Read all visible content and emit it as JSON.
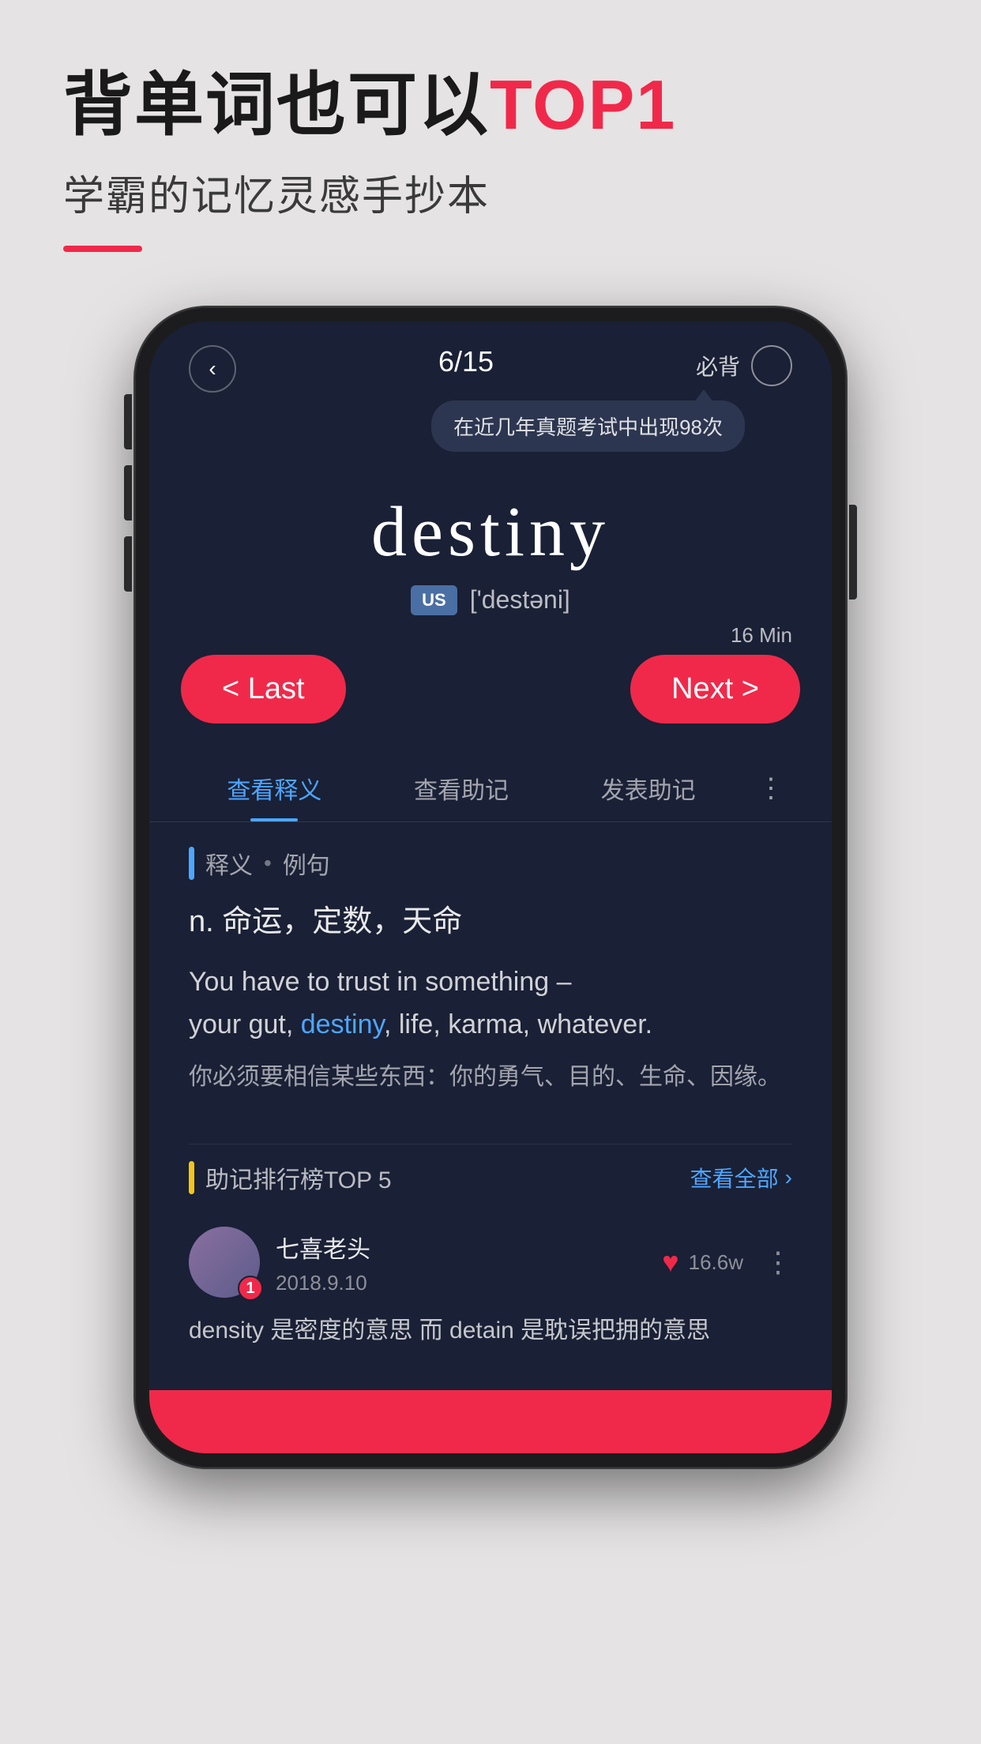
{
  "page": {
    "background_color": "#e5e3e3"
  },
  "header": {
    "title_part1": "背单词也可以",
    "title_highlight": "TOP1",
    "subtitle": "学霸的记忆灵感手抄本",
    "underline_color": "#f0294a"
  },
  "phone": {
    "progress": "6/15",
    "must_label": "必背",
    "tooltip_text": "在近几年真题考试中出现98次",
    "word": "destiny",
    "phonetic_tag": "US",
    "phonetic": "['destəni]",
    "timer": "16 Min",
    "btn_last": "< Last",
    "btn_next": "Next >",
    "tabs": [
      {
        "label": "查看释义",
        "active": true
      },
      {
        "label": "查看助记",
        "active": false
      },
      {
        "label": "发表助记",
        "active": false
      }
    ],
    "section_definition": {
      "header_label1": "释义",
      "header_dot": "•",
      "header_label2": "例句",
      "definition": "n.  命运，定数，天命",
      "example_en_before": "You have to trust in something –",
      "example_en_word": "your gut, ",
      "example_en_highlight": "destiny",
      "example_en_after": ", life, karma, whatever.",
      "example_zh": "你必须要相信某些东西：你的勇气、目的、生命、因缘。"
    },
    "mnemonic_section": {
      "title": "助记排行榜TOP 5",
      "view_all": "查看全部",
      "user": {
        "name": "七喜老头",
        "date": "2018.9.10",
        "badge": "1",
        "like_count": "16.6w",
        "comment": "density 是密度的意思  而 detain 是耽误把拥的意思"
      }
    }
  }
}
